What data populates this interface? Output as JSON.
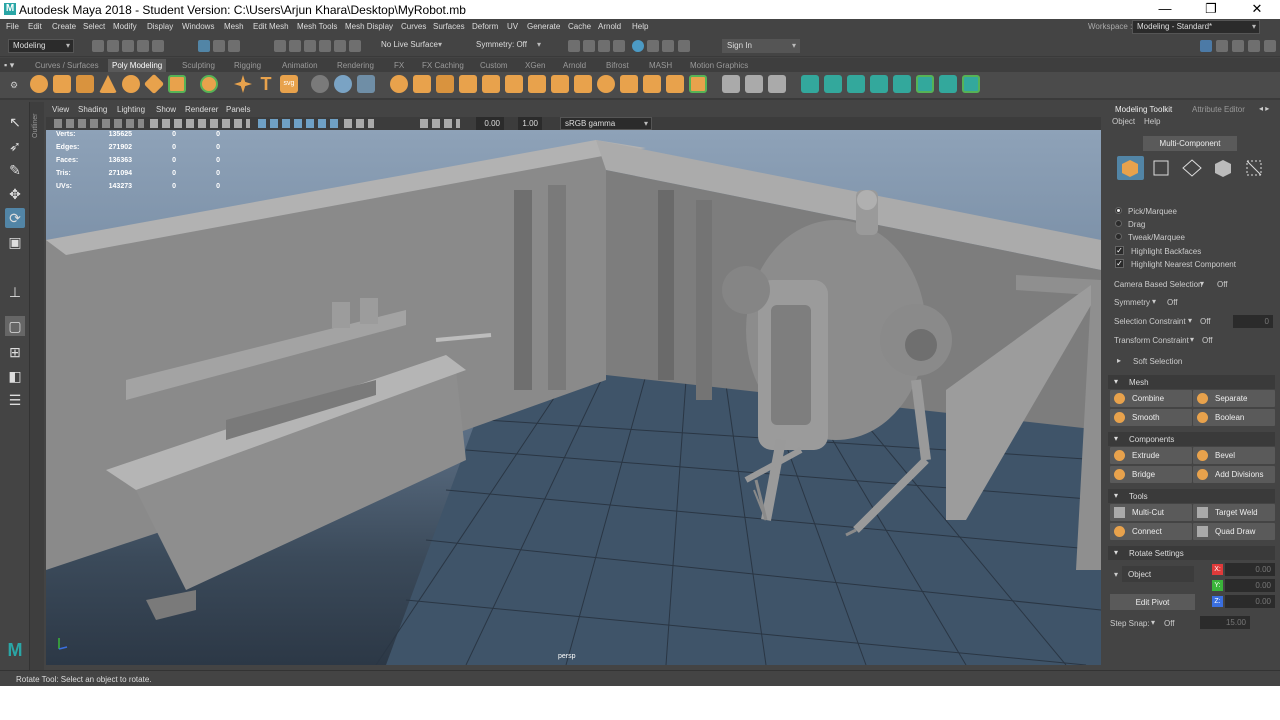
{
  "window": {
    "title": "Autodesk Maya 2018 - Student Version: C:\\Users\\Arjun Khara\\Desktop\\MyRobot.mb",
    "minimize": "—",
    "maximize": "❐",
    "close": "✕"
  },
  "menu": [
    "File",
    "Edit",
    "Create",
    "Select",
    "Modify",
    "Display",
    "Windows",
    "Mesh",
    "Edit Mesh",
    "Mesh Tools",
    "Mesh Display",
    "Curves",
    "Surfaces",
    "Deform",
    "UV",
    "Generate",
    "Cache",
    "Arnold",
    "Help"
  ],
  "workspace": {
    "label": "Workspace :",
    "value": "Modeling - Standard*"
  },
  "status": {
    "mode": "Modeling",
    "live_surface": "No Live Surface",
    "symmetry": "Symmetry: Off",
    "sign_in": "Sign In"
  },
  "shelf_tabs": [
    "Curves / Surfaces",
    "Poly Modeling",
    "Sculpting",
    "Rigging",
    "Animation",
    "Rendering",
    "FX",
    "FX Caching",
    "Custom",
    "XGen",
    "Arnold",
    "Bifrost",
    "MASH",
    "Motion Graphics"
  ],
  "shelf_active": "Poly Modeling",
  "panel_menu": [
    "View",
    "Shading",
    "Lighting",
    "Show",
    "Renderer",
    "Panels"
  ],
  "panel_toolbar": {
    "exposure": "0.00",
    "gamma": "1.00",
    "color_space": "sRGB gamma"
  },
  "outliner_label": "Outliner",
  "hud": {
    "rows": [
      {
        "label": "Verts:",
        "v1": "135625",
        "v2": "0",
        "v3": "0"
      },
      {
        "label": "Edges:",
        "v1": "271902",
        "v2": "0",
        "v3": "0"
      },
      {
        "label": "Faces:",
        "v1": "136363",
        "v2": "0",
        "v3": "0"
      },
      {
        "label": "Tris:",
        "v1": "271094",
        "v2": "0",
        "v3": "0"
      },
      {
        "label": "UVs:",
        "v1": "143273",
        "v2": "0",
        "v3": "0"
      }
    ],
    "camera": "persp"
  },
  "toolkit": {
    "tabs": [
      "Modeling Toolkit",
      "Attribute Editor"
    ],
    "menu": [
      "Object",
      "Help"
    ],
    "multi_component": "Multi-Component",
    "options": [
      {
        "label": "Pick/Marquee",
        "type": "radio",
        "on": true
      },
      {
        "label": "Drag",
        "type": "radio",
        "on": false
      },
      {
        "label": "Tweak/Marquee",
        "type": "radio",
        "on": false
      },
      {
        "label": "Highlight Backfaces",
        "type": "check",
        "on": true
      },
      {
        "label": "Highlight Nearest Component",
        "type": "check",
        "on": true
      }
    ],
    "camera_based": {
      "label": "Camera Based Selection",
      "value": "Off"
    },
    "symmetry": {
      "label": "Symmetry",
      "value": "Off"
    },
    "selection_constraint": {
      "label": "Selection Constraint",
      "value": "Off",
      "field": "0"
    },
    "transform_constraint": {
      "label": "Transform Constraint",
      "value": "Off"
    },
    "soft_selection": "Soft Selection",
    "sections": {
      "mesh": {
        "title": "Mesh",
        "buttons": [
          "Combine",
          "Separate",
          "Smooth",
          "Boolean"
        ]
      },
      "components": {
        "title": "Components",
        "buttons": [
          "Extrude",
          "Bevel",
          "Bridge",
          "Add Divisions"
        ]
      },
      "tools": {
        "title": "Tools",
        "buttons": [
          "Multi-Cut",
          "Target Weld",
          "Connect",
          "Quad Draw"
        ]
      },
      "rotate": {
        "title": "Rotate Settings"
      }
    },
    "rotate_space": "Object",
    "axes": [
      {
        "axis": "X:",
        "value": "0.00",
        "color": "#e03a3a"
      },
      {
        "axis": "Y:",
        "value": "0.00",
        "color": "#3ab53a"
      },
      {
        "axis": "Z:",
        "value": "0.00",
        "color": "#3a6fe0"
      }
    ],
    "edit_pivot": "Edit Pivot",
    "step_snap": {
      "label": "Step Snap:",
      "value": "Off",
      "field": "15.00"
    }
  },
  "help_line": "Rotate Tool: Select an object to rotate."
}
